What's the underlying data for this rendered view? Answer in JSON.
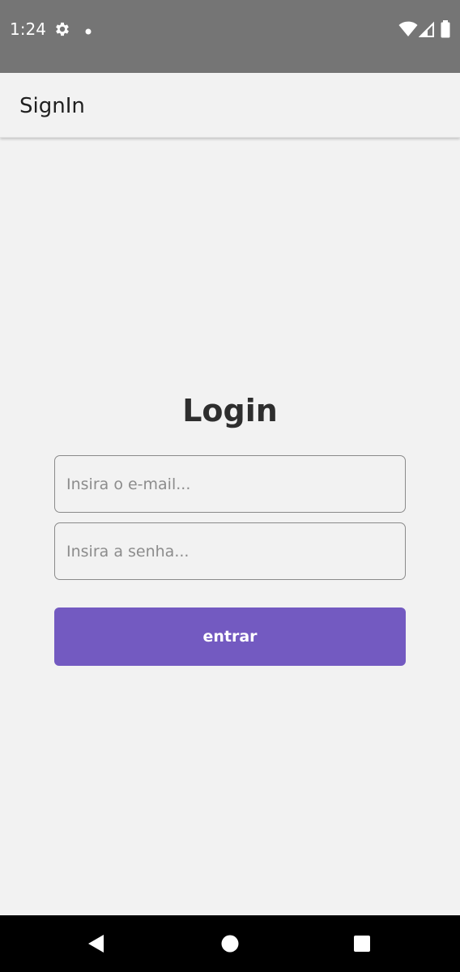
{
  "status_bar": {
    "time": "1:24",
    "icons": [
      "gear-icon",
      "notification-dot-icon",
      "wifi-icon",
      "cell-signal-icon",
      "battery-icon"
    ]
  },
  "app_bar": {
    "title": "SignIn"
  },
  "login": {
    "title": "Login",
    "email_placeholder": "Insira o e-mail...",
    "email_value": "",
    "password_placeholder": "Insira a senha...",
    "password_value": "",
    "submit_label": "entrar"
  },
  "nav_bar": {
    "icons": [
      "back-icon",
      "home-icon",
      "recents-icon"
    ]
  },
  "colors": {
    "status_bar": "#757575",
    "background": "#f2f2f2",
    "accent": "#735ac1",
    "nav_bar": "#000000"
  }
}
